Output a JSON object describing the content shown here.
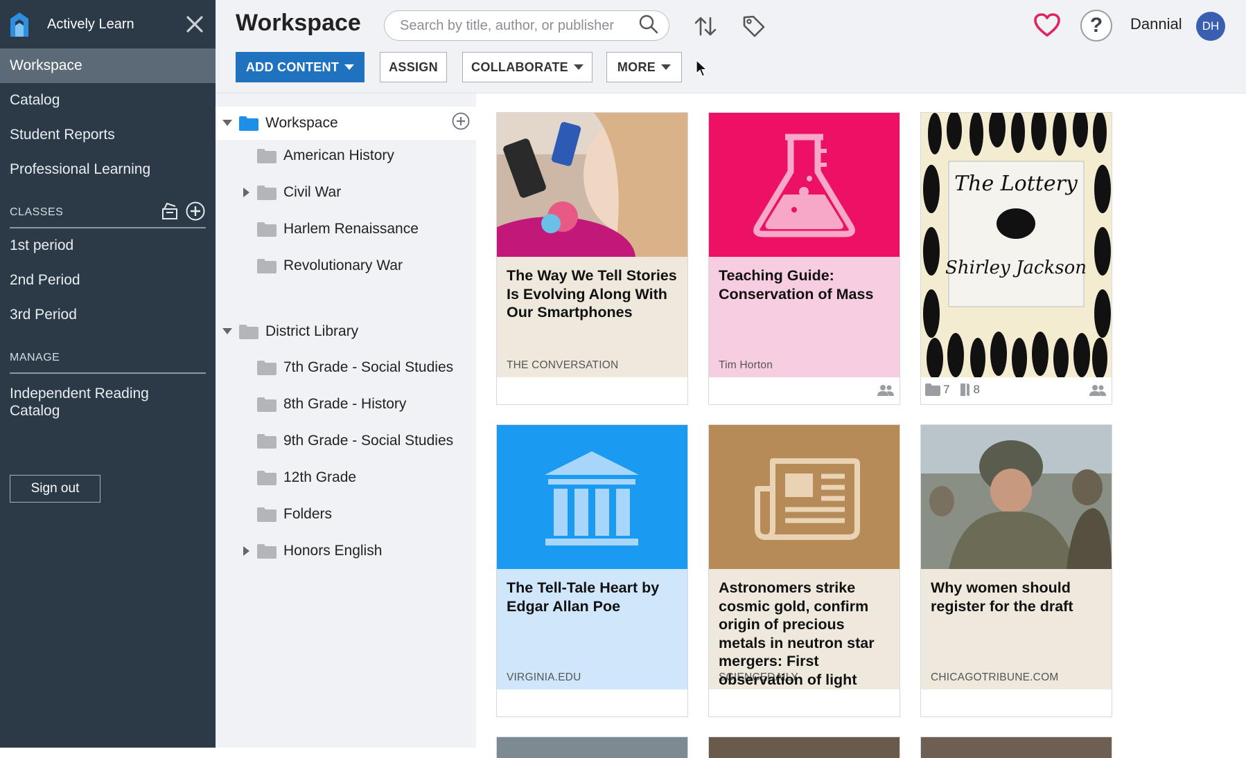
{
  "app": {
    "name": "Actively Learn"
  },
  "sidebar": {
    "nav": [
      {
        "label": "Workspace",
        "active": true
      },
      {
        "label": "Catalog"
      },
      {
        "label": "Student Reports"
      },
      {
        "label": "Professional Learning"
      }
    ],
    "classes_label": "CLASSES",
    "classes": [
      "1st period",
      "2nd Period",
      "3rd Period"
    ],
    "manage_label": "MANAGE",
    "manage": [
      "Independent Reading Catalog"
    ],
    "sign_out": "Sign out"
  },
  "header": {
    "title": "Workspace",
    "search_placeholder": "Search by title, author, or publisher",
    "username": "Dannial",
    "avatar_initials": "DH",
    "buttons": {
      "add": "ADD CONTENT",
      "assign": "ASSIGN",
      "collaborate": "COLLABORATE",
      "more": "MORE"
    }
  },
  "tree": {
    "workspace": {
      "label": "Workspace",
      "children": [
        "American History",
        "Civil War",
        "Harlem Renaissance",
        "Revolutionary War"
      ]
    },
    "district": {
      "label": "District Library",
      "children": [
        "7th Grade - Social Studies",
        "8th Grade - History",
        "9th Grade - Social Studies",
        "12th Grade",
        "Folders",
        "Honors English"
      ]
    }
  },
  "cards": [
    {
      "title": "The Way We Tell Stories Is Evolving Along With Our Smartphones",
      "source": "THE CONVERSATION"
    },
    {
      "title": "Teaching Guide: Conservation of Mass",
      "source": "Tim Horton"
    },
    {
      "title": "",
      "source": "",
      "folders": "7",
      "books": "8",
      "image_text_1": "The Lottery",
      "image_text_2": "Shirley Jackson"
    },
    {
      "title": "The Tell-Tale Heart by Edgar Allan Poe",
      "source": "VIRGINIA.EDU"
    },
    {
      "title": "Astronomers strike cosmic gold, confirm origin of precious metals in neutron star mergers: First observation of light",
      "source": "SCIENCEDAILY"
    },
    {
      "title": "Why women should register for the draft",
      "source": "CHICAGOTRIBUNE.COM"
    }
  ],
  "colors": {
    "sidebar_bg": "#2b3a46",
    "sidebar_active": "#5b6a76",
    "primary": "#1f72be",
    "folder_blue": "#1e8fe6",
    "heart": "#e0245e",
    "science_pink": "#ec1165",
    "history_blue": "#1a9af0",
    "news_brown": "#b68b57"
  }
}
